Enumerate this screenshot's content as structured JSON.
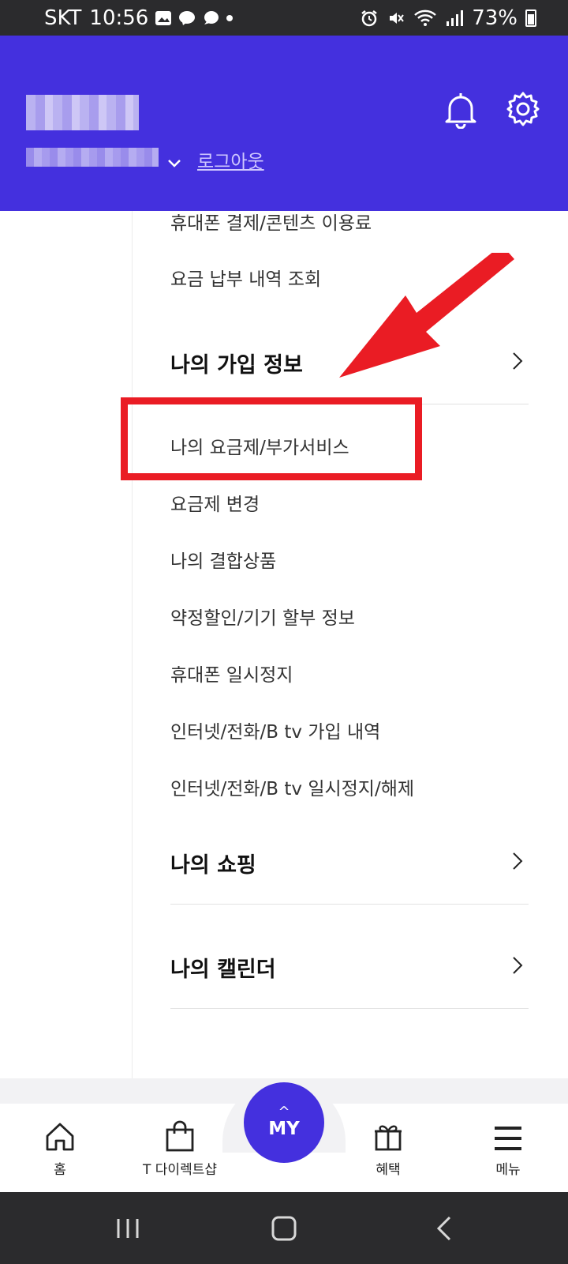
{
  "status_bar": {
    "carrier": "SKT",
    "time": "10:56",
    "battery": "73%",
    "battery_level": 0.73
  },
  "header": {
    "logout_label": "로그아웃",
    "bg_color": "#4430de"
  },
  "menu": {
    "items_top": [
      {
        "label": "휴대폰 결제/콘텐츠 이용료"
      },
      {
        "label": "요금 납부 내역 조회"
      }
    ],
    "sections": [
      {
        "title": "나의 가입 정보",
        "items": [
          {
            "label": "나의 요금제/부가서비스",
            "highlighted": true
          },
          {
            "label": "요금제 변경"
          },
          {
            "label": "나의 결합상품"
          },
          {
            "label": "약정할인/기기 할부 정보"
          },
          {
            "label": "휴대폰 일시정지"
          },
          {
            "label": "인터넷/전화/B tv 가입 내역"
          },
          {
            "label": "인터넷/전화/B tv 일시정지/해제"
          }
        ]
      },
      {
        "title": "나의 쇼핑"
      },
      {
        "title": "나의 캘린더"
      }
    ]
  },
  "bottom_nav": {
    "home": "홈",
    "direct_shop": "T 다이렉트샵",
    "my": "MY",
    "benefits": "혜택",
    "menu": "메뉴"
  },
  "annotation": {
    "highlight_color": "#ea1c24"
  }
}
